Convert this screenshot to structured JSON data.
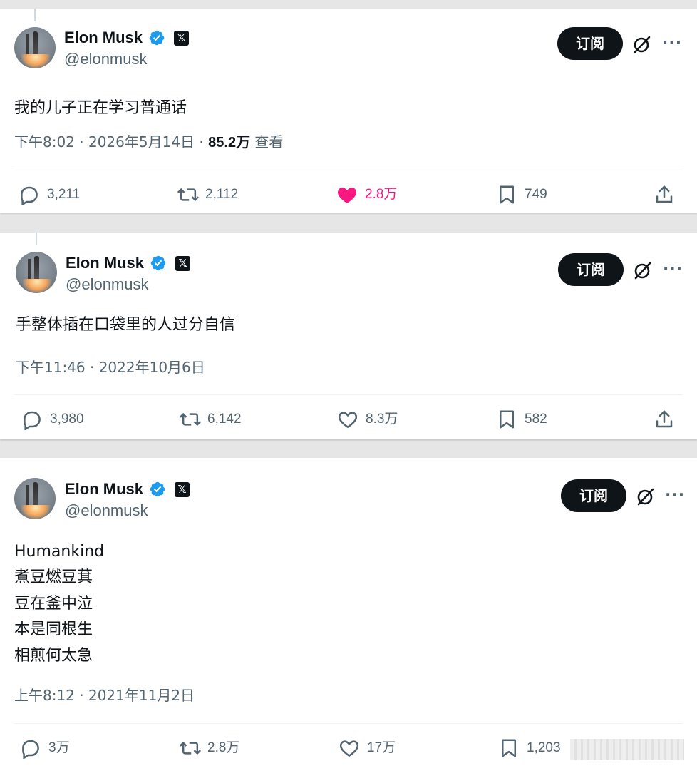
{
  "author": {
    "name": "Elon Musk",
    "handle": "@elonmusk",
    "x_badge": "𝕏"
  },
  "subscribe_label": "订阅",
  "icons": {
    "verified": "verified-badge-icon",
    "grok": "grok-icon",
    "more": "more-icon",
    "reply": "reply-icon",
    "repost": "repost-icon",
    "like": "heart-icon",
    "bookmark": "bookmark-icon",
    "share": "share-icon"
  },
  "colors": {
    "verified": "#1d9bf0",
    "like_active": "#f91880",
    "muted": "#536471"
  },
  "posts": [
    {
      "text": "我的儿子正在学习普通话",
      "time": "下午8:02 · 2026年5月14日 · ",
      "views": "85.2万",
      "views_label": " 查看",
      "replies": "3,211",
      "reposts": "2,112",
      "likes": "2.8万",
      "bookmarks": "749",
      "liked": true
    },
    {
      "text": "手整体插在口袋里的人过分自信",
      "time": "下午11:46 · 2022年10月6日",
      "replies": "3,980",
      "reposts": "6,142",
      "likes": "8.3万",
      "bookmarks": "582",
      "liked": false
    },
    {
      "lines": [
        "Humankind",
        "煮豆燃豆萁",
        "豆在釜中泣",
        "本是同根生",
        "相煎何太急"
      ],
      "time": "上午8:12 · 2021年11月2日",
      "replies": "3万",
      "reposts": "2.8万",
      "likes": "17万",
      "bookmarks": "1,203",
      "liked": false
    }
  ]
}
